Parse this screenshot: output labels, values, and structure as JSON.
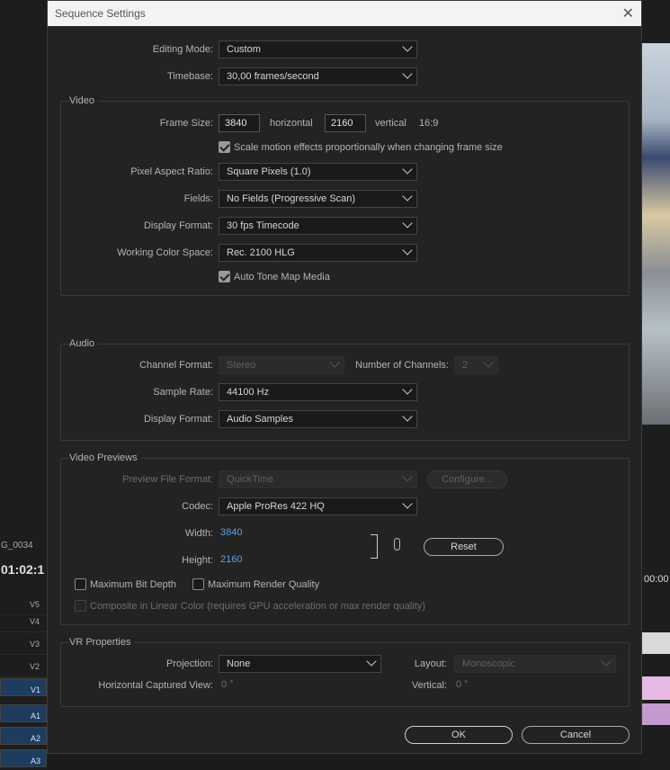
{
  "background": {
    "sequence_name": "G_0034",
    "timecode": "01:02:1",
    "timecode_right": "00:00",
    "tracks": [
      "V5",
      "V4",
      "V3",
      "V2",
      "V1",
      "A1",
      "A2",
      "A3"
    ]
  },
  "dialog": {
    "title": "Sequence Settings",
    "close_glyph": "✕",
    "editing_mode": {
      "label": "Editing Mode:",
      "value": "Custom"
    },
    "timebase": {
      "label": "Timebase:",
      "value": "30,00  frames/second"
    },
    "video": {
      "title": "Video",
      "frame_size": {
        "label": "Frame Size:",
        "width": "3840",
        "horizontal": "horizontal",
        "height": "2160",
        "vertical": "vertical",
        "ratio": "16:9"
      },
      "scale_motion": {
        "label": "Scale motion effects proportionally when changing frame size",
        "checked": true
      },
      "pixel_aspect": {
        "label": "Pixel Aspect Ratio:",
        "value": "Square Pixels (1.0)"
      },
      "fields": {
        "label": "Fields:",
        "value": "No Fields (Progressive Scan)"
      },
      "display_format": {
        "label": "Display Format:",
        "value": "30 fps Timecode"
      },
      "working_color_space": {
        "label": "Working Color Space:",
        "value": "Rec. 2100 HLG"
      },
      "auto_tone_map": {
        "label": "Auto Tone Map Media",
        "checked": true
      }
    },
    "audio": {
      "title": "Audio",
      "channel_format": {
        "label": "Channel Format:",
        "value": "Stereo"
      },
      "num_channels": {
        "label": "Number of Channels:",
        "value": "2"
      },
      "sample_rate": {
        "label": "Sample Rate:",
        "value": "44100 Hz"
      },
      "display_format": {
        "label": "Display Format:",
        "value": "Audio Samples"
      }
    },
    "video_previews": {
      "title": "Video Previews",
      "preview_file_format": {
        "label": "Preview File Format:",
        "value": "QuickTime"
      },
      "configure": "Configure...",
      "codec": {
        "label": "Codec:",
        "value": "Apple ProRes 422 HQ"
      },
      "width": {
        "label": "Width:",
        "value": "3840"
      },
      "height": {
        "label": "Height:",
        "value": "2160"
      },
      "reset": "Reset",
      "max_bit_depth": {
        "label": "Maximum Bit Depth",
        "checked": false
      },
      "max_render_quality": {
        "label": "Maximum Render Quality",
        "checked": false
      },
      "composite_linear": {
        "label": "Composite in Linear Color (requires GPU acceleration or max render quality)",
        "checked": false
      }
    },
    "vr": {
      "title": "VR Properties",
      "projection": {
        "label": "Projection:",
        "value": "None"
      },
      "layout": {
        "label": "Layout:",
        "value": "Monoscopic"
      },
      "h_captured": {
        "label": "Horizontal Captured View:",
        "value": "0 °"
      },
      "vertical": {
        "label": "Vertical:",
        "value": "0 °"
      }
    },
    "ok": "OK",
    "cancel": "Cancel"
  }
}
